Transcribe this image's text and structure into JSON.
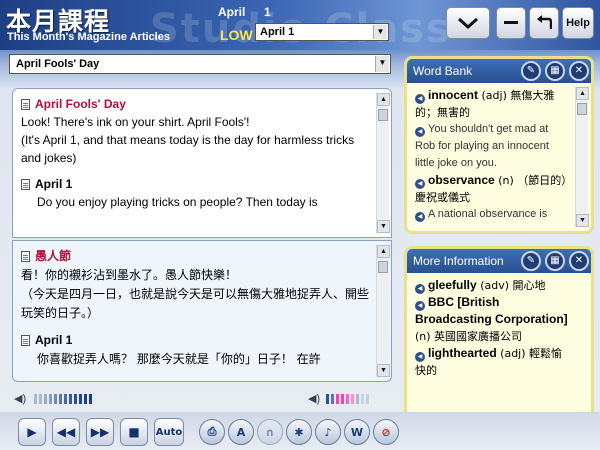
{
  "header": {
    "title_cn": "本月課程",
    "title_en": "This Month's Magazine Articles",
    "watermark": "Studio Class",
    "month": "April",
    "day": "1",
    "level": "LOW",
    "issue_select": "April 1",
    "buttons": {
      "collapse_icon": "chevron-down-icon",
      "minimize_icon": "minus-icon",
      "back_icon": "undo-arrow-icon",
      "help": "Help"
    }
  },
  "article_select": "April Fools' Day",
  "english_pane": {
    "title": "April Fools' Day",
    "line1": "Look! There's ink on your shirt. April Fools'!",
    "line2": "(It's April 1, and that means today is the day for harmless tricks and jokes)",
    "section": "April 1",
    "section_text": "Do you enjoy playing tricks on people?  Then today is"
  },
  "chinese_pane": {
    "title": "愚人節",
    "line1": "看！你的襯衫沾到墨水了。愚人節快樂！",
    "line2": "（今天是四月一日，也就是說今天是可以無傷大雅地捉弄人、開些玩笑的日子。）",
    "section": "April 1",
    "section_text": "你喜歡捉弄人嗎？ 那麼今天就是「你的」日子！ 在許"
  },
  "word_bank": {
    "title": "Word Bank",
    "entries": [
      {
        "word": "innocent",
        "def": "(adj) 無傷大雅的；無害的"
      },
      {
        "example": "You shouldn't get mad at Rob for playing an innocent little joke on you."
      },
      {
        "word": "observance",
        "def": "(n) （節日的）慶祝或儀式"
      },
      {
        "example": "A national observance is"
      }
    ]
  },
  "more_info": {
    "title": "More Information",
    "entries": [
      {
        "word": "gleefully",
        "def": "(adv) 開心地"
      },
      {
        "word": "BBC [British Broadcasting Corporation]",
        "def": "(n) 英國國家廣播公司"
      },
      {
        "word": "lighthearted",
        "def": "(adj) 輕鬆愉快的"
      }
    ]
  },
  "controls": {
    "play_icon": "play-icon",
    "rewind_icon": "rewind-icon",
    "forward_icon": "fast-forward-icon",
    "stop_icon": "stop-icon",
    "auto": "Auto"
  },
  "colors": {
    "accent": "#2d4f8c",
    "level": "#f5e64a",
    "cn_title": "#b0103a"
  }
}
